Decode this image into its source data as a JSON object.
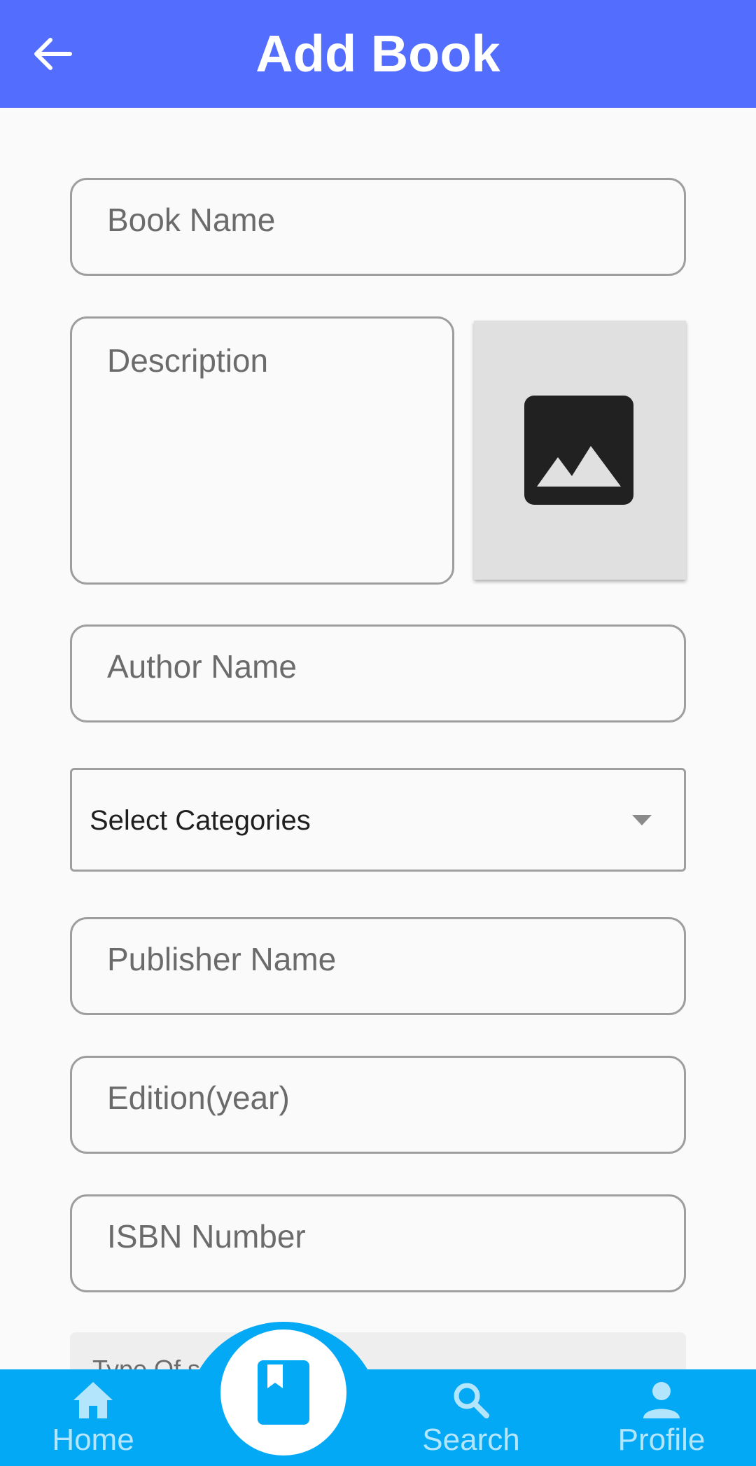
{
  "appbar": {
    "title": "Add Book",
    "back_icon": "arrow-left-icon",
    "color": "#536dfe"
  },
  "form": {
    "book_name": {
      "placeholder": "Book Name",
      "value": ""
    },
    "description": {
      "placeholder": "Description",
      "value": ""
    },
    "image_picker": {
      "icon": "image-icon"
    },
    "author_name": {
      "placeholder": "Author Name",
      "value": ""
    },
    "categories": {
      "selected": "Select Categories",
      "icon": "dropdown-caret-icon"
    },
    "publisher_name": {
      "placeholder": "Publisher Name",
      "value": ""
    },
    "edition_year": {
      "placeholder": "Edition(year)",
      "value": ""
    },
    "isbn_number": {
      "placeholder": "ISBN Number",
      "value": ""
    },
    "type_of_sale_partial": {
      "label": "Type Of s"
    }
  },
  "bottom_nav": {
    "color": "#03a9f4",
    "items": [
      {
        "label": "Home",
        "icon": "home-icon"
      },
      {
        "label": "",
        "icon": "book-icon"
      },
      {
        "label": "Search",
        "icon": "search-icon"
      },
      {
        "label": "Profile",
        "icon": "person-icon"
      }
    ]
  }
}
